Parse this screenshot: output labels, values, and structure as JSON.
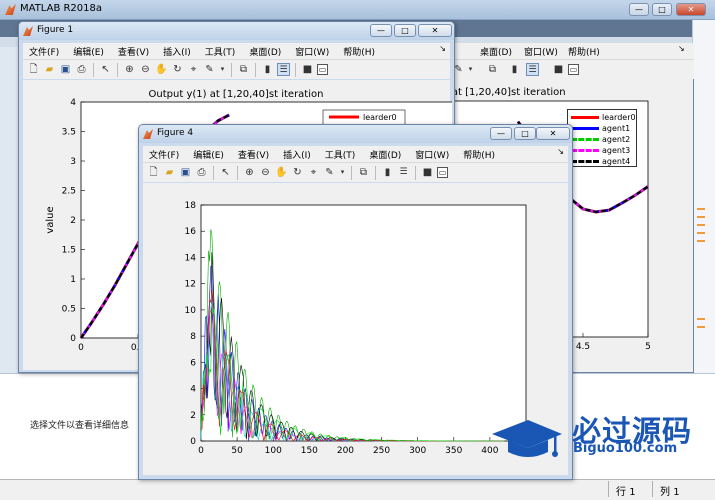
{
  "desktop": {
    "title": "MATLAB R2018a",
    "controls": {
      "min": "—",
      "max": "□",
      "close": "✕"
    },
    "select_info": "选择文件以查看详细信息",
    "status": {
      "row_label": "行",
      "row_value": "1",
      "col_label": "列",
      "col_value": "1"
    }
  },
  "menu": [
    "文件(F)",
    "编辑(E)",
    "查看(V)",
    "插入(I)",
    "工具(T)",
    "桌面(D)",
    "窗口(W)",
    "帮助(H)"
  ],
  "menu_overflow": "↘",
  "toolbar_icons": [
    "new-file-icon",
    "open-folder-icon",
    "save-icon",
    "print-icon",
    "pointer-icon",
    "zoom-in-icon",
    "zoom-out-icon",
    "pan-hand-icon",
    "rotate-3d-icon",
    "data-cursor-icon",
    "brush-icon",
    "dropdown-arrow-icon",
    "link-plot-icon",
    "colorbar-icon",
    "legend-icon",
    "hide-tools-icon",
    "show-tools-icon"
  ],
  "fig1": {
    "title": "Figure 1",
    "controls": {
      "min": "—",
      "max": "□",
      "close": "✕"
    },
    "chart_title": "Output y(1) at [1,20,40]st iteration",
    "chart_title_right": "1) at [1,20,40]st iteration",
    "ylabel": "value"
  },
  "fig4": {
    "title": "Figure 4",
    "controls": {
      "min": "—",
      "max": "□",
      "close": "✕"
    }
  },
  "colors": {
    "leader": "#ff0000",
    "agent1": "#0000ff",
    "agent2": "#00cc00",
    "agent3": "#ff00ff",
    "agent4": "#000000"
  },
  "watermark": {
    "title": "必过源码",
    "url": "Biguo100.com"
  },
  "chart_data": [
    {
      "type": "line",
      "title": "Output y(1) at [1,20,40]st iteration",
      "xlabel": "",
      "ylabel": "value",
      "xlim": [
        0,
        5
      ],
      "ylim": [
        0,
        4
      ],
      "x_ticks_visible": [
        0,
        0.5,
        4,
        4.5,
        5
      ],
      "x_tick_labels": [
        "0",
        "0.5",
        "4",
        "4.5",
        "5"
      ],
      "y_ticks": [
        0,
        0.5,
        1,
        1.5,
        2,
        2.5,
        3,
        3.5,
        4
      ],
      "y_tick_labels": [
        "0",
        "0.5",
        "1",
        "1.5",
        "2",
        "2.5",
        "3",
        "3.5",
        "4"
      ],
      "legend": [
        "learder0",
        "agent1",
        "agent2",
        "agent3",
        "agent4"
      ],
      "legend_placement": "top-right",
      "grid": false,
      "x": [
        0,
        0.1,
        0.2,
        0.3,
        0.4,
        0.5,
        0.6,
        0.7,
        0.8,
        0.9,
        1.0,
        1.1,
        1.2,
        1.3
      ],
      "y": [
        0,
        0.28,
        0.58,
        0.9,
        1.25,
        1.6,
        1.95,
        2.3,
        2.65,
        2.97,
        3.25,
        3.5,
        3.68,
        3.78
      ],
      "x_right_visible": [
        4.0,
        4.1,
        4.2,
        4.3,
        4.4,
        4.5,
        4.6,
        4.7,
        4.8,
        4.9,
        5.0
      ],
      "y_right_visible": [
        3.65,
        3.35,
        3.0,
        2.65,
        2.35,
        2.17,
        2.12,
        2.15,
        2.27,
        2.4,
        2.55
      ]
    },
    {
      "type": "line",
      "title": "",
      "xlabel": "",
      "ylabel": "",
      "xlim": [
        0,
        450
      ],
      "ylim": [
        0,
        18
      ],
      "x_ticks": [
        0,
        50,
        100,
        150,
        200,
        250,
        300,
        350,
        400
      ],
      "x_tick_labels": [
        "0",
        "50",
        "100",
        "150",
        "200",
        "250",
        "300",
        "350",
        "400"
      ],
      "y_ticks": [
        0,
        2,
        4,
        6,
        8,
        10,
        12,
        14,
        16,
        18
      ],
      "y_tick_labels": [
        "0",
        "2",
        "4",
        "6",
        "8",
        "10",
        "12",
        "14",
        "16",
        "18"
      ],
      "grid": false,
      "series": [
        {
          "color": "#0000ff",
          "peak_x": 8,
          "peak": 15.2,
          "decay": 40
        },
        {
          "color": "#00aa00",
          "peak_x": 12,
          "peak": 16.4,
          "decay": 45
        },
        {
          "color": "#000000",
          "peak_x": 15,
          "peak": 14.3,
          "decay": 42
        },
        {
          "color": "#ff00ff",
          "peak_x": 10,
          "peak": 10.5,
          "decay": 38
        },
        {
          "color": "#00cccc",
          "peak_x": 9,
          "peak": 12.0,
          "decay": 36
        },
        {
          "color": "#ff0000",
          "peak_x": 11,
          "peak": 11.2,
          "decay": 40
        },
        {
          "color": "#00dd00",
          "peak_x": 14,
          "peak": 9.8,
          "decay": 50
        }
      ]
    }
  ]
}
